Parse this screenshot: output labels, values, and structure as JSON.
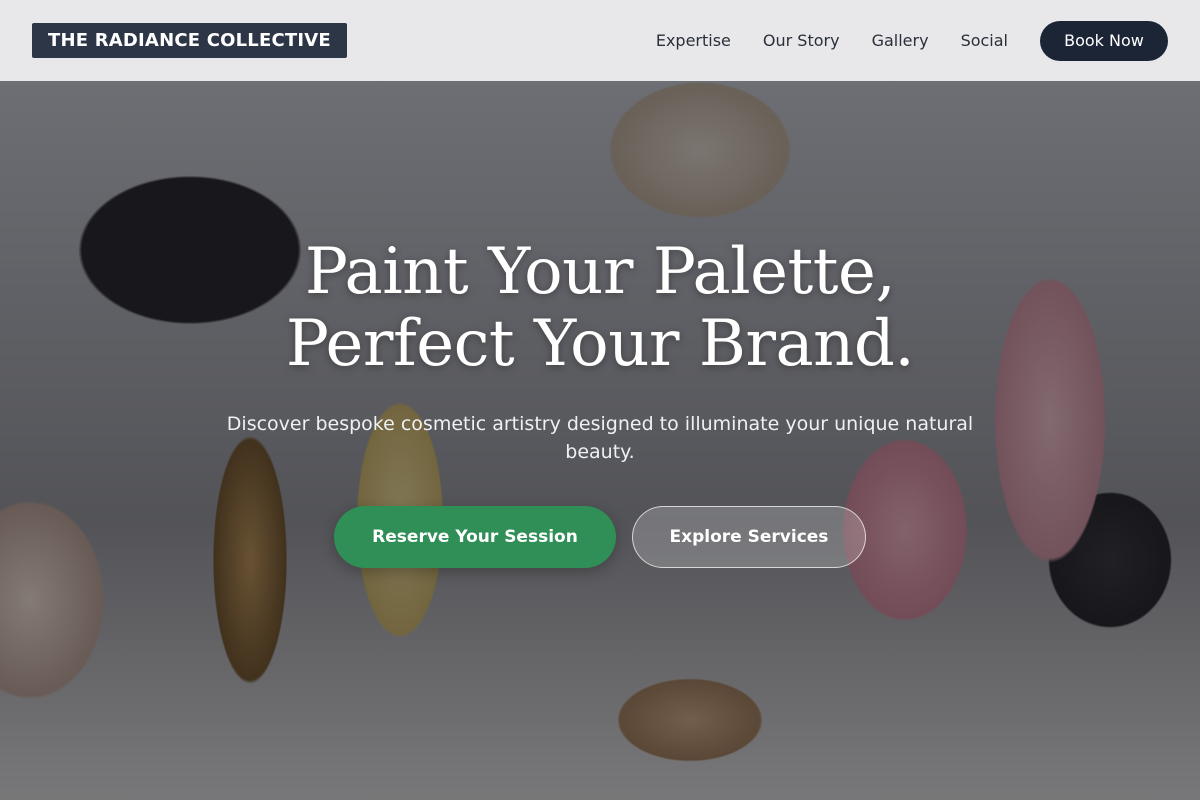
{
  "header": {
    "brand": "THE RADIANCE COLLECTIVE",
    "nav": [
      "Expertise",
      "Our Story",
      "Gallery",
      "Social"
    ],
    "book_label": "Book Now"
  },
  "hero": {
    "background_image": "cosmetics-vanity-photo",
    "title": "Paint Your Palette, Perfect Your Brand.",
    "subtitle": "Discover bespoke cosmetic artistry designed to illuminate your unique natural beauty.",
    "primary_cta": "Reserve Your Session",
    "secondary_cta": "Explore Services"
  },
  "colors": {
    "brand_bg": "#2c3646",
    "book_button": "#1c2535",
    "primary_cta": "#2f8f57"
  }
}
